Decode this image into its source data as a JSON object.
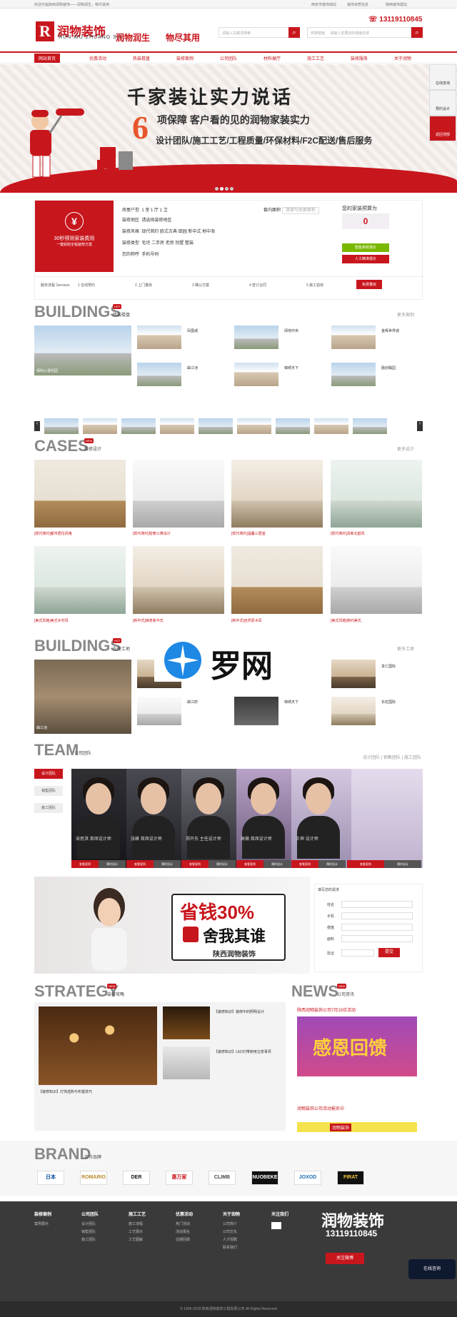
{
  "topbar": {
    "welcome": "欢迎光临陕西润物装饰——润物润生，物尽其用",
    "links": [
      "西安市装饰城站",
      "装饰资质信息",
      "陕西装饰建站"
    ]
  },
  "header": {
    "logo_char": "R",
    "logo_cn": "润物装饰",
    "logo_en": "RUN WU ZHUANG SHI",
    "slogan1": "润物润生",
    "slogan2": "物尽其用",
    "search_placeholder": "请输入关键词搜索",
    "search2_select": "热搜楼盘",
    "search2_placeholder": "请输入您要找的楼盘名称",
    "phone": "13119110845"
  },
  "nav": [
    "网站首页",
    "优惠活动",
    "热装楼盘",
    "装修案例",
    "公司团队",
    "材料展厅",
    "施工工艺",
    "装修服务",
    "关于润物"
  ],
  "banner": {
    "headline": "千家装让实力说话",
    "num": "6",
    "line1": "项保障 客户看的见的润物家装实力",
    "line2": "设计团队/施工工艺/工程质量/环保材料/F2C配送/售后服务"
  },
  "sidebar": [
    "在线咨询",
    "预约设计",
    "返回顶部"
  ],
  "quote": {
    "box_title": "30秒预测家装费用",
    "box_sub": "一键获取全程装修方案",
    "rows": [
      {
        "label": "房屋户型",
        "value": "1 室 1 厅 1 卫"
      },
      {
        "label": "装修地区",
        "value": "请选择装修地区"
      },
      {
        "label": "装修风格",
        "value": "现代简约  欧式古典  田园  新中式  地中海"
      },
      {
        "label": "装修类型",
        "value": "毛坯  二手房  老房  别墅  整装"
      },
      {
        "label": "您的称呼",
        "value": "手机号码"
      }
    ],
    "area_label": "套内面积",
    "area_placeholder": "请填写房屋面积",
    "estimate_title": "您的家装预算为",
    "estimate_value": "0",
    "btn_green": "智能系统报价",
    "btn_red": "人工精准报价",
    "steps_label": "服务流程 Services",
    "steps": [
      "1 在线预约",
      "2 上门量房",
      "3 确认方案",
      "4 签订合同",
      "5 施工验收"
    ],
    "free_btn": "免费量房"
  },
  "buildings": {
    "title": "BUILDINGS",
    "cn": "热装楼盘",
    "more": "更多案例",
    "items": [
      "保利心语花园",
      "凤凰城",
      "绿地中央",
      "曲江池",
      "金辉世界城",
      "锦绣天下",
      "融创臻园"
    ]
  },
  "cases": {
    "title": "CASES",
    "cn": "装修设计",
    "more": "更多设计",
    "items": [
      "[现代简约]都市居住风格",
      "[现代简约]轻奢公寓设计",
      "[现代简约]温馨三居室",
      "[现代简约]清新北欧风",
      "[美式风格]美式乡村风",
      "[新中式]禅意新中式",
      "[新中式]自然原木风",
      "[美式风格]简约美式"
    ]
  },
  "buildings2": {
    "title": "BUILDINGS",
    "cn": "在建工地",
    "more": "更多工地",
    "watermark": "罗网",
    "items": [
      "曲江池",
      "贵仁国际",
      "曲江府",
      "长虹国际",
      "锦绣天下"
    ]
  },
  "team": {
    "title": "TEAM",
    "cn": "公司团队",
    "tabs": [
      "设计团队",
      "销售团队",
      "施工团队"
    ],
    "members": [
      {
        "name": "宋思淇",
        "title": "首席设计师"
      },
      {
        "name": "张峰",
        "title": "首席设计师"
      },
      {
        "name": "郑开东",
        "title": "主任设计师"
      },
      {
        "name": "高薇",
        "title": "首席设计师"
      },
      {
        "name": "王坤",
        "title": "设计师"
      }
    ],
    "btn_case": "查看案例",
    "btn_book": "预约设计"
  },
  "promo": {
    "headline": "省钱30%",
    "sub": "舍我其谁",
    "brand": "陕西润物装饰",
    "form_title": "填写您的需求",
    "fields": [
      "姓名",
      "手机",
      "楼盘",
      "面积",
      "验证"
    ],
    "submit": "提交"
  },
  "strategy": {
    "title": "STRATEGY",
    "cn": "装修攻略",
    "items": [
      "【装修知识】灯饰选购与布置技巧",
      "【装修知识】装修中的照明设计",
      "【装修知识】LED灯带使用注意事项"
    ]
  },
  "news": {
    "title": "NEWS",
    "cn": "公司资讯",
    "headline": "陕西润物装饰公司7月19日活动",
    "banner": "感恩回馈",
    "item2": "润物装饰公司活动报名中"
  },
  "brand_sec": {
    "title": "BRAND",
    "cn": "合作品牌",
    "brands": [
      "日本",
      "ROMARIO",
      "DER",
      "惠万家",
      "CLIMB",
      "NUOBEKE",
      "JOXOD",
      "FIRAT"
    ]
  },
  "footer": {
    "cols": [
      {
        "title": "装修案例",
        "items": [
          "案例展示"
        ]
      },
      {
        "title": "公司团队",
        "items": [
          "设计团队",
          "销售团队",
          "施工团队"
        ]
      },
      {
        "title": "施工工艺",
        "items": [
          "施工流程",
          "工艺展示",
          "工艺图解"
        ]
      },
      {
        "title": "优惠活动",
        "items": [
          "热门活动",
          "活动报名",
          "往期回顾"
        ]
      },
      {
        "title": "关于润物",
        "items": [
          "公司简介",
          "公司文化",
          "人才招聘",
          "联系我们"
        ]
      },
      {
        "title": "关注我们",
        "items": []
      }
    ],
    "logo": "润物装饰",
    "phone": "13119110845",
    "weibo": "关注微博",
    "copyright": "© 1999-2018 陕西润物装饰工程有限公司 All Rights Reserved"
  },
  "colors": {
    "brand": "#c8161d",
    "dark": "#3a3a3a"
  }
}
